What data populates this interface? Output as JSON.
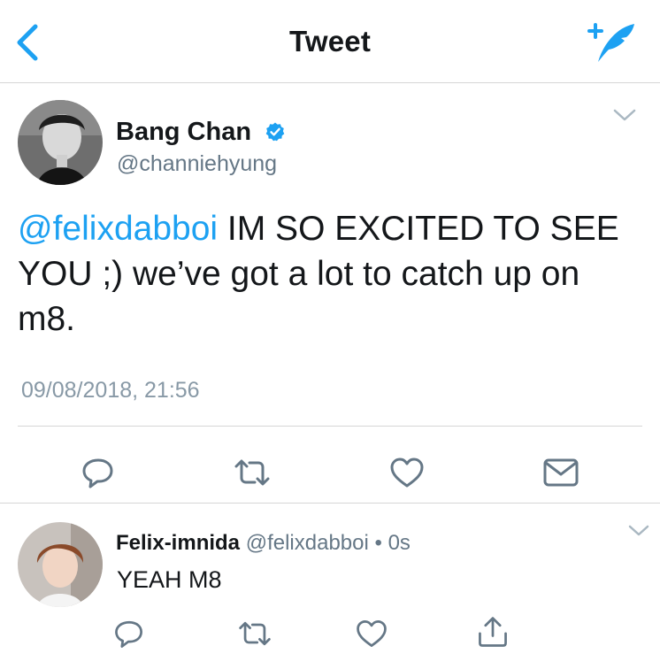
{
  "navbar": {
    "title": "Tweet",
    "back_icon": "chevron-left-icon",
    "compose_icon": "compose-tweet-icon"
  },
  "main_tweet": {
    "display_name": "Bang Chan",
    "verified": true,
    "handle": "@channiehyung",
    "mention": "@felixdabboi",
    "text_body": " IM SO EXCITED TO SEE YOU ;) we’ve got a lot to catch up on m8.",
    "timestamp": "09/08/2018, 21:56",
    "actions": [
      "reply-icon",
      "retweet-icon",
      "like-icon",
      "direct-message-icon"
    ]
  },
  "reply_tweet": {
    "display_name": "Felix-imnida",
    "handle": "@felixdabboi",
    "separator": "•",
    "time": "0s",
    "text": "YEAH M8",
    "actions": [
      "reply-icon",
      "retweet-icon",
      "like-icon",
      "share-icon"
    ]
  },
  "colors": {
    "accent": "#1da1f2",
    "text": "#14171a",
    "secondary": "#657786",
    "icon_gray": "#657786",
    "divider": "#d6d6d6"
  }
}
